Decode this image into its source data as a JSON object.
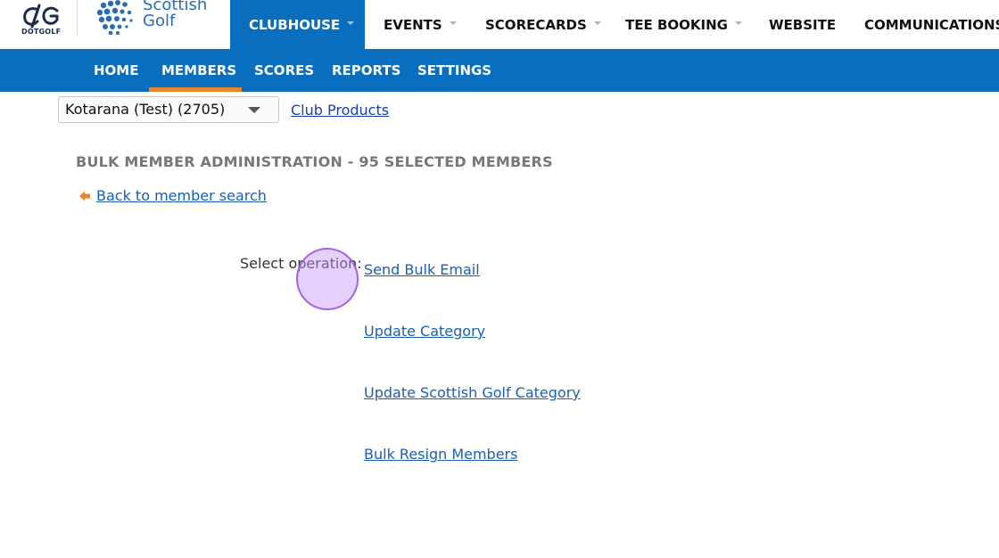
{
  "brand": {
    "dotgolf_label": "DOTGOLF",
    "scottish_golf_line1": "Scottish",
    "scottish_golf_line2": "Golf"
  },
  "top_nav": {
    "clubhouse": "CLUBHOUSE",
    "events": "EVENTS",
    "scorecards": "SCORECARDS",
    "tee_booking": "TEE BOOKING",
    "website": "WEBSITE",
    "communications": "COMMUNICATIONS"
  },
  "sub_nav": {
    "home": "HOME",
    "members": "MEMBERS",
    "scores": "SCORES",
    "reports": "REPORTS",
    "settings": "SETTINGS",
    "active": "MEMBERS"
  },
  "club_selector": {
    "selected": "Kotarana (Test) (2705)"
  },
  "club_products_link": "Club Products",
  "page": {
    "heading": "BULK MEMBER ADMINISTRATION - 95 SELECTED MEMBERS",
    "back_link": "Back to member search",
    "operation_label": "Select operation:",
    "operations": [
      "Send Bulk Email",
      "Update Category",
      "Update Scottish Golf Category",
      "Bulk Resign Members"
    ]
  },
  "colors": {
    "primary_blue": "#0a6ebf",
    "active_underline": "#e8862a",
    "link": "#1a5fb4",
    "heading_gray": "#777777"
  }
}
